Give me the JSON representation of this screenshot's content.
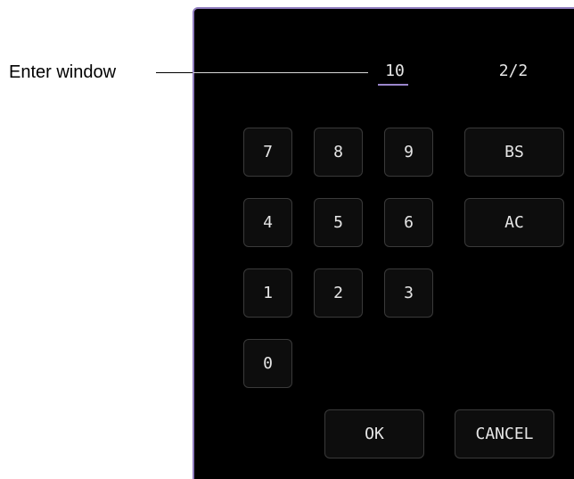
{
  "annotation": {
    "label": "Enter window"
  },
  "entry": {
    "value": "10",
    "counter": "2/2"
  },
  "keypad": {
    "k7": "7",
    "k8": "8",
    "k9": "9",
    "k4": "4",
    "k5": "5",
    "k6": "6",
    "k1": "1",
    "k2": "2",
    "k3": "3",
    "k0": "0",
    "backspace": "BS",
    "clear": "AC"
  },
  "dialog": {
    "ok": "OK",
    "cancel": "CANCEL"
  },
  "colors": {
    "panel_background": "#000000",
    "panel_border": "#8e7bbd",
    "entry_underline": "#9a86cc",
    "key_background": "#0d0d0d",
    "key_border": "#3a3a3a",
    "text": "#e6e6e6"
  }
}
